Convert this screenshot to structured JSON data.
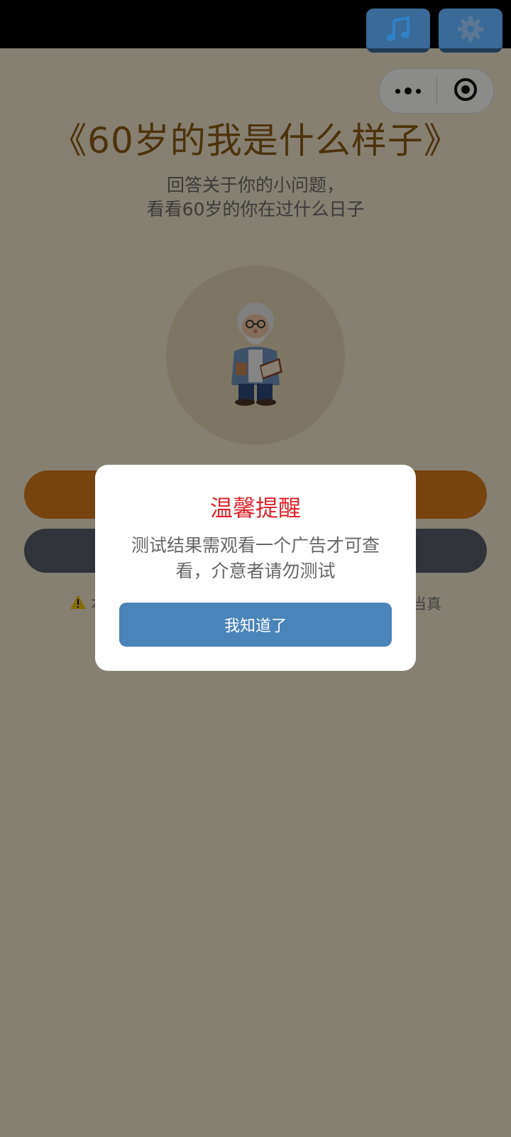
{
  "header": {
    "music_icon": "music-note-icon",
    "settings_icon": "gear-icon",
    "capsule": {
      "more_icon": "more-dots-icon",
      "close_icon": "target-circle-icon"
    }
  },
  "hero": {
    "title": "《60岁的我是什么样子》",
    "subtitle_line1": "回答关于你的小问题，",
    "subtitle_line2": "看看60岁的你在过什么日子",
    "avatar": "old-man-reading-illustration"
  },
  "background_content": {
    "disclaimer_left": "本",
    "disclaimer_right": "当真"
  },
  "modal": {
    "title": "温馨提醒",
    "message": "测试结果需观看一个广告才可查看，介意者请勿测试",
    "button_label": "我知道了"
  },
  "colors": {
    "title": "#8b5e12",
    "modal_title": "#e0262b",
    "modal_button": "#4a84b8",
    "primary_button": "#d97c1c",
    "secondary_button": "#58606a"
  }
}
